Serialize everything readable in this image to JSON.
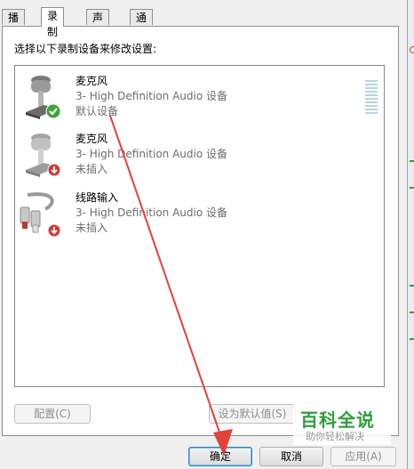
{
  "tabs": [
    {
      "label": "播放"
    },
    {
      "label": "录制"
    },
    {
      "label": "声音"
    },
    {
      "label": "通信"
    }
  ],
  "instruction": "选择以下录制设备来修改设置:",
  "devices": [
    {
      "name": "麦克风",
      "description": "3- High Definition Audio 设备",
      "status": "默认设备",
      "icon": "microphone-icon",
      "badge": "green-check-icon"
    },
    {
      "name": "麦克风",
      "description": "3- High Definition Audio 设备",
      "status": "未插入",
      "icon": "microphone-icon",
      "badge": "red-unplugged-icon"
    },
    {
      "name": "线路输入",
      "description": "3- High Definition Audio 设备",
      "status": "未插入",
      "icon": "line-in-cable-icon",
      "badge": "red-unplugged-icon"
    }
  ],
  "buttons": {
    "configure": "配置(C)",
    "set_default": "设为默认值(S)",
    "ok": "确定",
    "cancel": "取消",
    "apply": "应用(A)"
  },
  "watermark": {
    "title": "百科全说",
    "subtitle": "助你轻松解决"
  },
  "colors": {
    "arrow": "#e5403a",
    "check": "#3aa53a",
    "unplugged": "#d23a3a",
    "watermark": "#2e9e3a"
  }
}
